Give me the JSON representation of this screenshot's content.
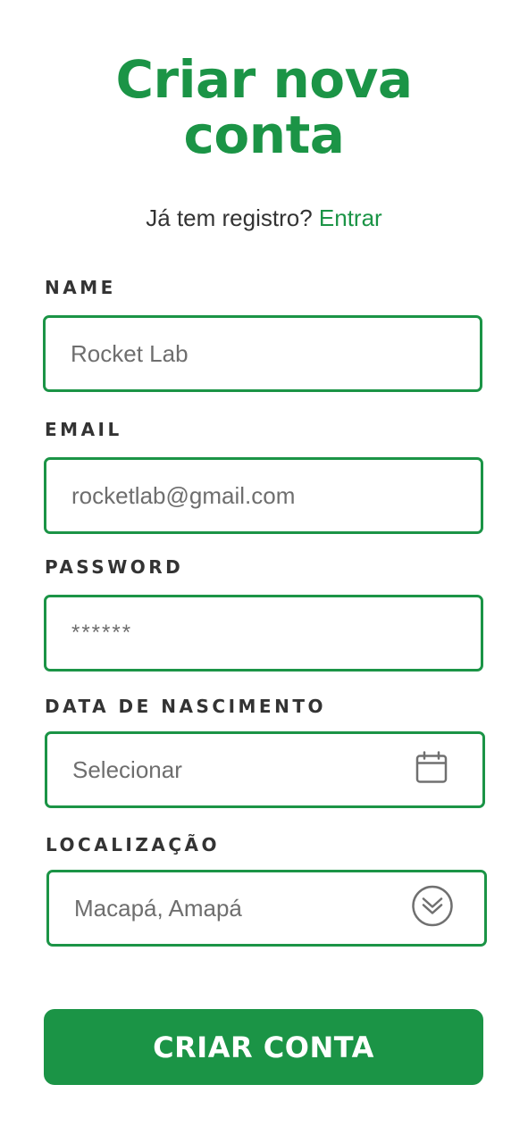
{
  "header": {
    "title_line1": "Criar nova",
    "title_line2": "conta",
    "login_prompt": "Já tem registro?",
    "login_link": "Entrar"
  },
  "form": {
    "name": {
      "label": "NAME",
      "value": "Rocket Lab"
    },
    "email": {
      "label": "EMAIL",
      "value": "rocketlab@gmail.com"
    },
    "password": {
      "label": "PASSWORD",
      "value": "******"
    },
    "birthdate": {
      "label": "DATA DE NASCIMENTO",
      "placeholder": "Selecionar",
      "icon": "calendar-icon"
    },
    "location": {
      "label": "LOCALIZAÇÃO",
      "value": "Macapá, Amapá",
      "icon": "chevron-down-circle-icon"
    }
  },
  "submit_label": "CRIAR CONTA",
  "colors": {
    "accent": "#1b9446",
    "text": "#333333",
    "muted": "#6e6e6e"
  }
}
